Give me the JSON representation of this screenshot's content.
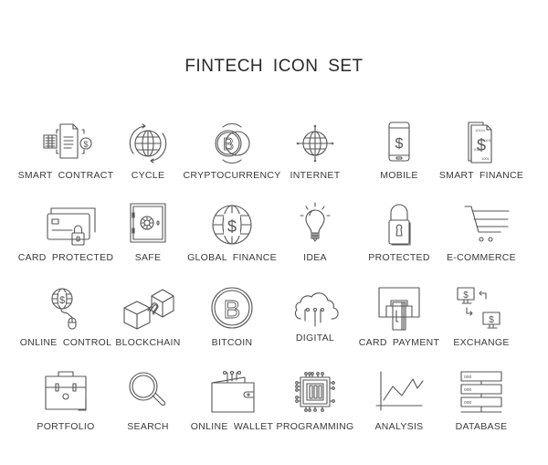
{
  "title": "FINTECH ICON SET",
  "icons": [
    {
      "label": "SMART CONTRACT",
      "icon": "smart-contract-icon"
    },
    {
      "label": "CYCLE",
      "icon": "cycle-icon"
    },
    {
      "label": "CRYPTOCURRENCY",
      "icon": "cryptocurrency-icon"
    },
    {
      "label": "INTERNET",
      "icon": "internet-icon"
    },
    {
      "label": "MOBILE",
      "icon": "mobile-icon"
    },
    {
      "label": "SMART FINANCE",
      "icon": "smart-finance-icon"
    },
    {
      "label": "CARD PROTECTED",
      "icon": "card-protected-icon"
    },
    {
      "label": "SAFE",
      "icon": "safe-icon"
    },
    {
      "label": "GLOBAL FINANCE",
      "icon": "global-finance-icon"
    },
    {
      "label": "IDEA",
      "icon": "idea-icon"
    },
    {
      "label": "PROTECTED",
      "icon": "protected-icon"
    },
    {
      "label": "E-COMMERCE",
      "icon": "e-commerce-icon"
    },
    {
      "label": "ONLINE CONTROL",
      "icon": "online-control-icon"
    },
    {
      "label": "BLOCKCHAIN",
      "icon": "blockchain-icon"
    },
    {
      "label": "BITCOIN",
      "icon": "bitcoin-icon"
    },
    {
      "label": "DIGITAL",
      "icon": "digital-icon"
    },
    {
      "label": "CARD PAYMENT",
      "icon": "card-payment-icon"
    },
    {
      "label": "EXCHANGE",
      "icon": "exchange-icon"
    },
    {
      "label": "PORTFOLIO",
      "icon": "portfolio-icon"
    },
    {
      "label": "SEARCH",
      "icon": "search-icon"
    },
    {
      "label": "ONLINE WALLET",
      "icon": "online-wallet-icon"
    },
    {
      "label": "PROGRAMMING",
      "icon": "programming-icon"
    },
    {
      "label": "ANALYSIS",
      "icon": "analysis-icon"
    },
    {
      "label": "DATABASE",
      "icon": "database-icon"
    }
  ],
  "glyphs": {
    "dollar": "$",
    "bitcoin": "B",
    "binary_a": "10110",
    "binary_b": "101",
    "binary_c": "011",
    "binary_d": "1001",
    "db_dots": "ooo"
  }
}
